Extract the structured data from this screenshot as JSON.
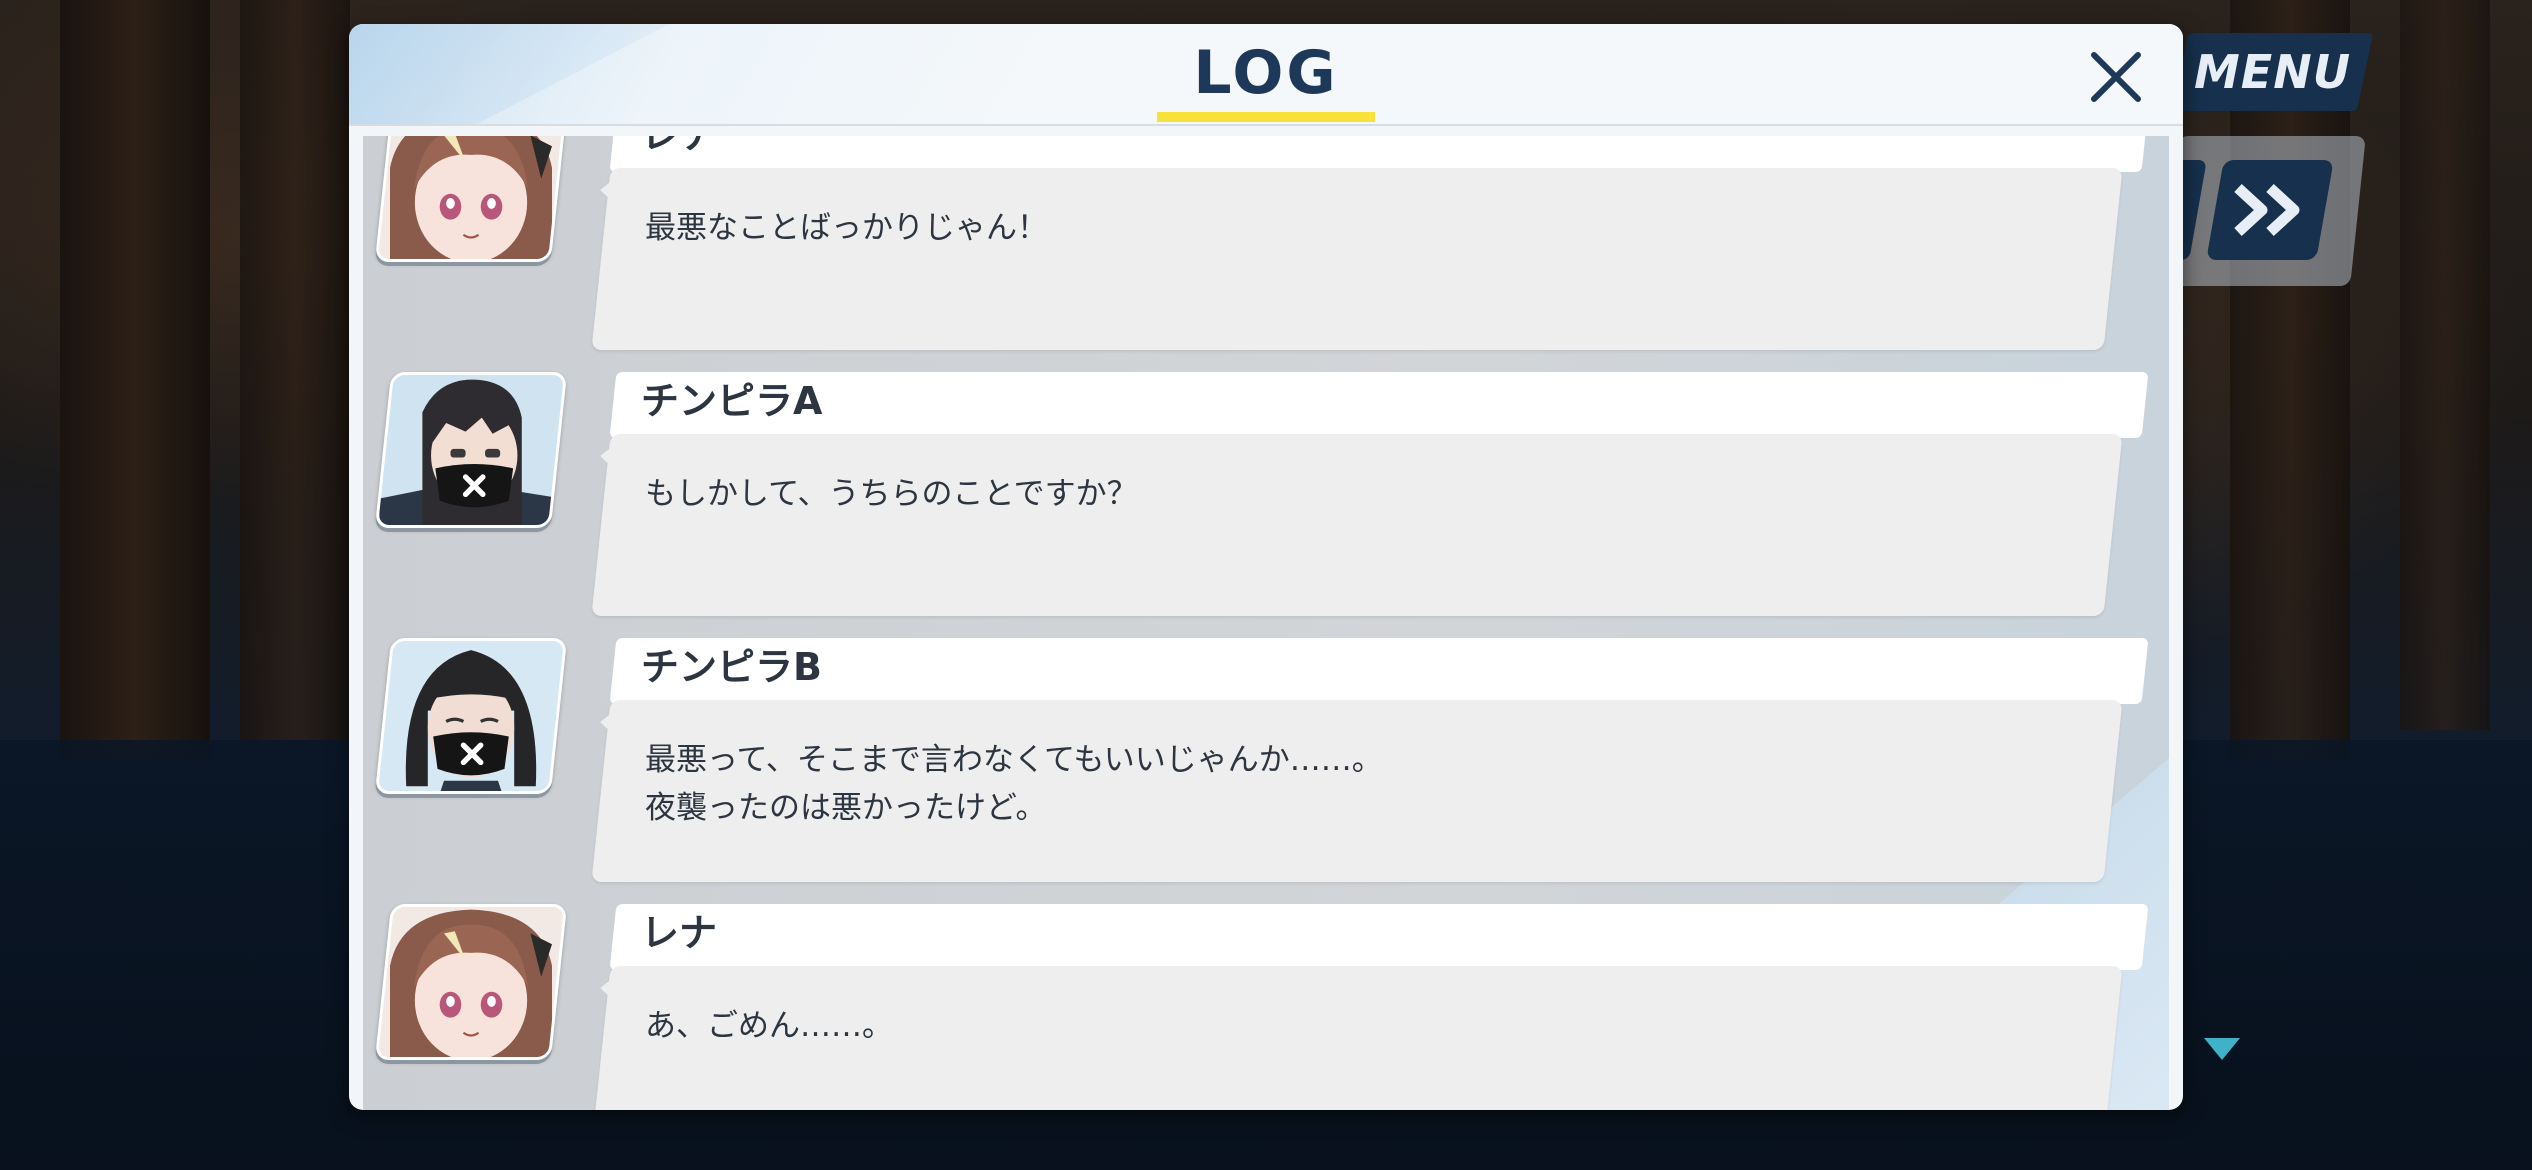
{
  "hud": {
    "menu_label": "MENU",
    "fast_forward_icon": "double-chevron-right-icon",
    "next_indicator_icon": "triangle-down-icon",
    "accent_color": "#3fb2c9",
    "button_color": "#16304d"
  },
  "log": {
    "title": "LOG",
    "close_icon": "close-icon",
    "underline_color": "#f7e13a",
    "entries": [
      {
        "speaker": "レナ",
        "text": "最悪なことばっかりじゃん！",
        "avatar": "rena"
      },
      {
        "speaker": "チンピラA",
        "text": "もしかして、うちらのことですか？",
        "avatar": "thug-a"
      },
      {
        "speaker": "チンピラB",
        "text": "最悪って、そこまで言わなくてもいいじゃんか……。\n夜襲ったのは悪かったけど。",
        "avatar": "thug-b"
      },
      {
        "speaker": "レナ",
        "text": "あ、ごめん……。",
        "avatar": "rena"
      }
    ]
  }
}
